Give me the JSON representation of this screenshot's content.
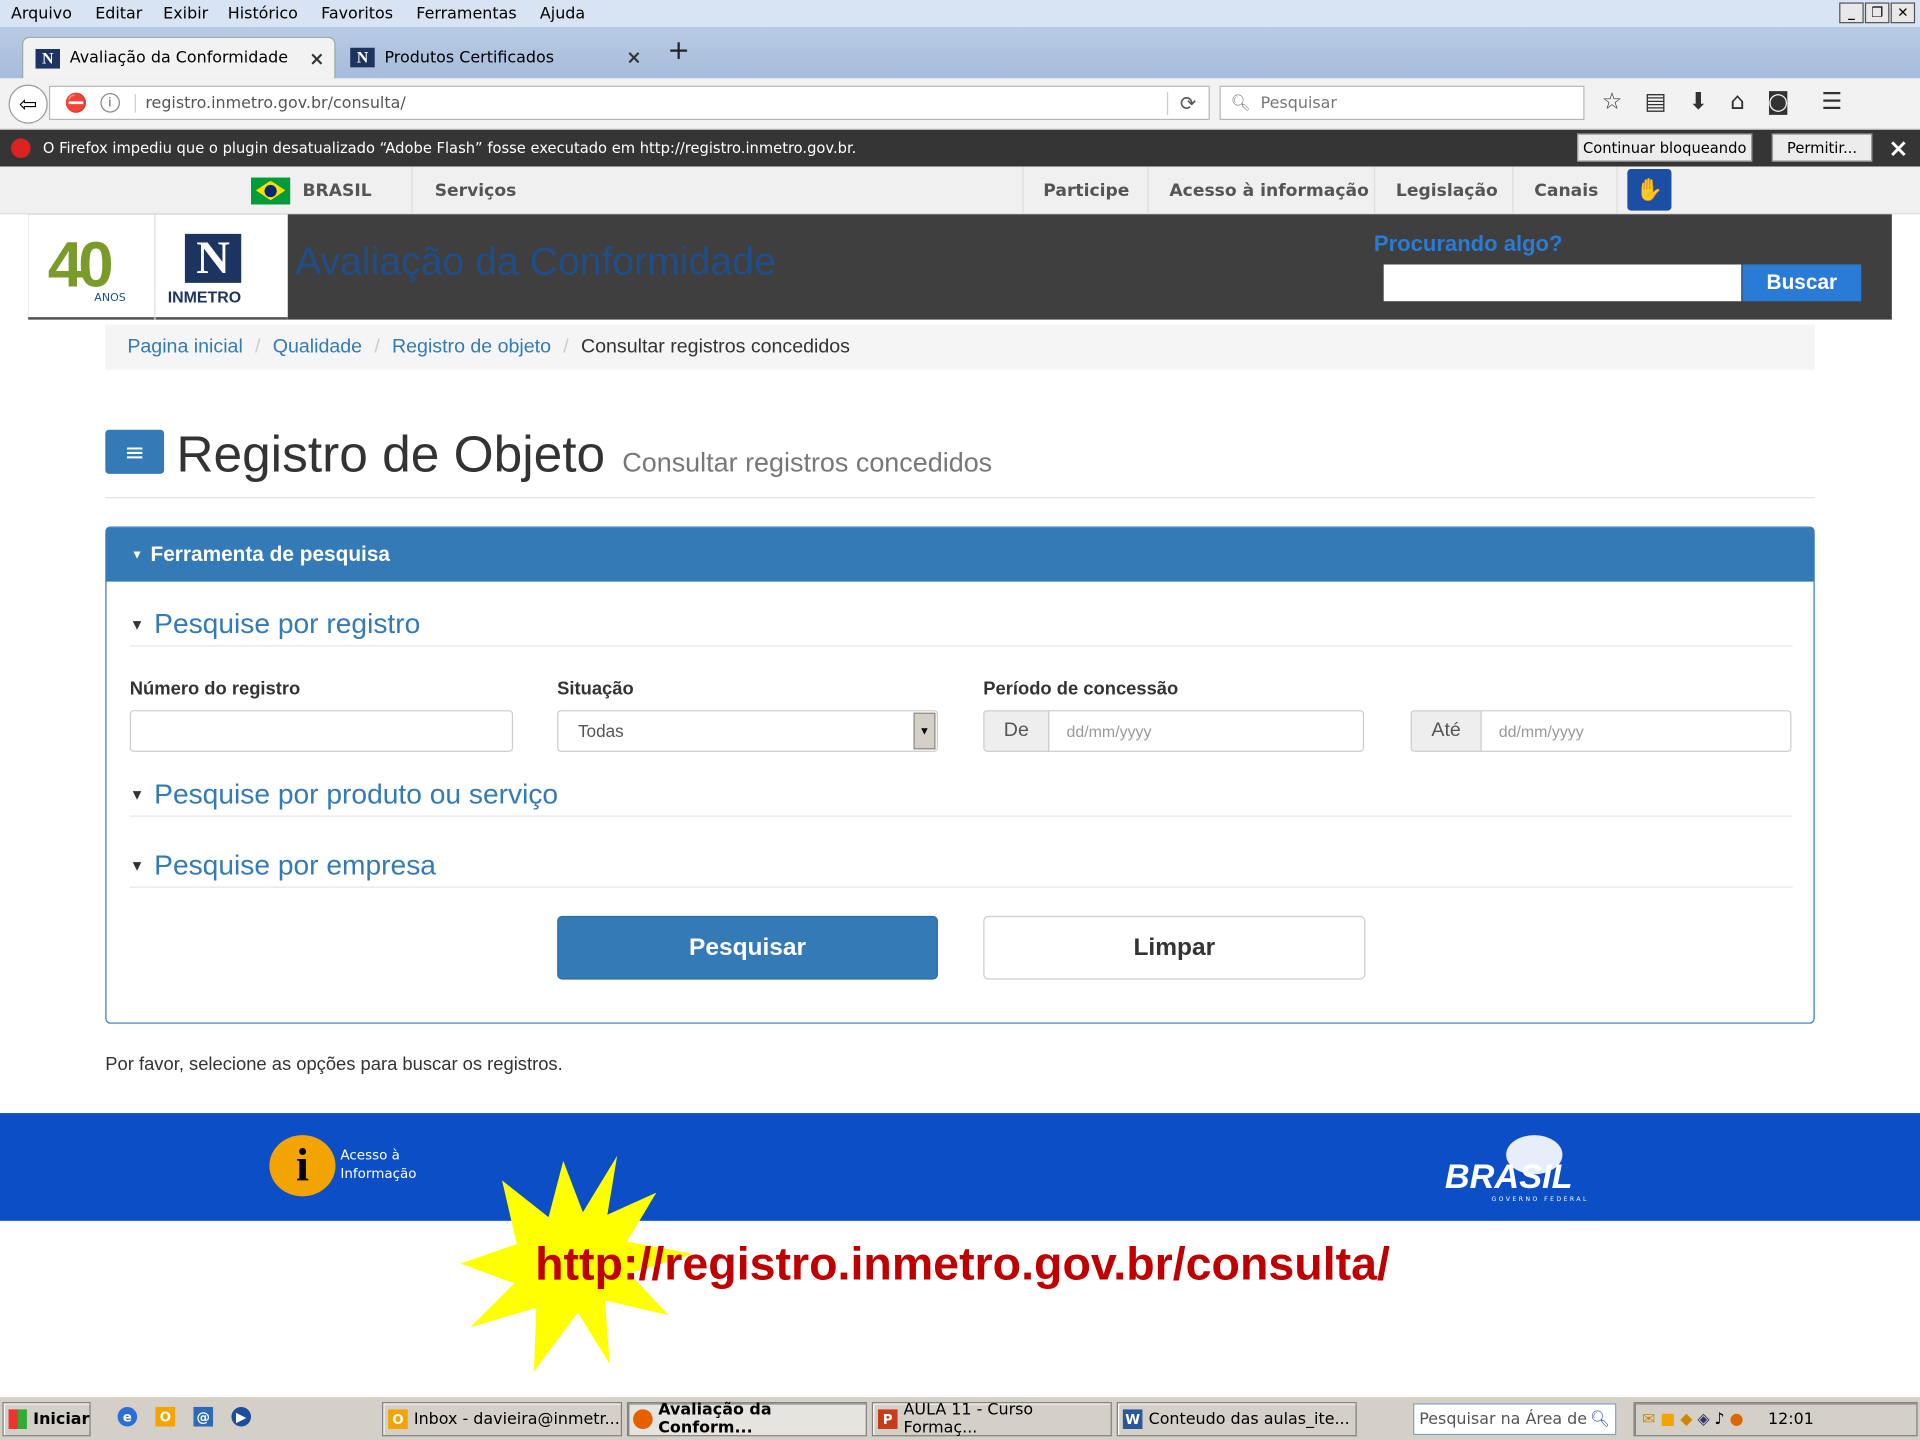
{
  "menu": [
    "Arquivo",
    "Editar",
    "Exibir",
    "Histórico",
    "Favoritos",
    "Ferramentas",
    "Ajuda"
  ],
  "tabs": [
    {
      "title": "Avaliação da Conformidade",
      "close": "×"
    },
    {
      "title": "Produtos Certificados",
      "close": "×"
    }
  ],
  "newtab": "+",
  "url": "registro.inmetro.gov.br/consulta/",
  "search_placeholder": "Pesquisar",
  "notification": {
    "text": "O Firefox impediu que o plugin desatualizado “Adobe Flash” fosse executado em http://registro.inmetro.gov.br.",
    "btn_block": "Continuar bloqueando",
    "btn_allow": "Permitir...",
    "close": "×"
  },
  "govbar": {
    "brasil": "BRASIL",
    "servicos": "Serviços",
    "links": [
      "Participe",
      "Acesso à informação",
      "Legislação",
      "Canais"
    ]
  },
  "header": {
    "logo_years": "40",
    "logo_anos": "ANOS",
    "logo_inmetro": "INMETRO",
    "title": "Avaliação da Conformidade",
    "search_label": "Procurando algo?",
    "search_button": "Buscar"
  },
  "breadcrumb": {
    "items": [
      "Pagina inicial",
      "Qualidade",
      "Registro de objeto"
    ],
    "current": "Consultar registros concedidos"
  },
  "page": {
    "menu_glyph": "≡",
    "title": "Registro de Objeto",
    "subtitle": "Consultar registros concedidos"
  },
  "panel": {
    "title": "Ferramenta de pesquisa",
    "sections": [
      "Pesquise por registro",
      "Pesquise por produto ou serviço",
      "Pesquise por empresa"
    ],
    "fields": {
      "numero_label": "Número do registro",
      "numero_value": "",
      "situacao_label": "Situação",
      "situacao_value": "Todas",
      "periodo_label": "Período de concessão",
      "de_label": "De",
      "de_placeholder": "dd/mm/yyyy",
      "ate_label": "Até",
      "ate_placeholder": "dd/mm/yyyy"
    },
    "btn_search": "Pesquisar",
    "btn_clear": "Limpar"
  },
  "hint": "Por favor, selecione as opções para buscar os registros.",
  "footer": {
    "acesso_line1": "Acesso à",
    "acesso_line2": "Informação",
    "brasil": "BRASIL",
    "brasil_sub": "GOVERNO FEDERAL"
  },
  "callout": "http://registro.inmetro.gov.br/consulta/",
  "taskbar": {
    "start": "Iniciar",
    "items": [
      "Inbox - davieira@inmetr...",
      "Avaliação da Conform...",
      "AULA 11 - Curso Formaç...",
      "Conteudo das aulas_ite..."
    ],
    "search_placeholder": "Pesquisar na Área de",
    "clock": "12:01"
  },
  "colors": {
    "primary": "#337ab7",
    "header_bg": "#3f3f3f",
    "footer_bg": "#0c4ec5",
    "callout": "#c00000"
  }
}
